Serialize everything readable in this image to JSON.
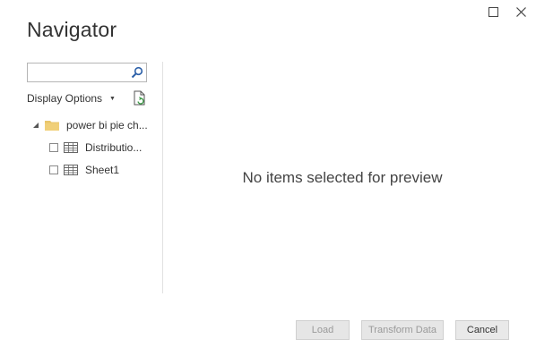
{
  "window": {
    "maximize_icon": "maximize-icon",
    "close_icon": "close-icon",
    "close_glyph": "✕"
  },
  "header": {
    "title": "Navigator"
  },
  "sidebar": {
    "search": {
      "value": "",
      "placeholder": "",
      "icon": "search-icon"
    },
    "display_options_label": "Display Options",
    "display_options_caret": "▼",
    "refresh_icon": "refresh-file-icon",
    "tree": {
      "root": {
        "label": "power bi pie ch...",
        "icon": "folder-icon",
        "expanded": true
      },
      "items": [
        {
          "label": "Distributio...",
          "icon": "table-icon",
          "checked": false
        },
        {
          "label": "Sheet1",
          "icon": "table-icon",
          "checked": false
        }
      ]
    }
  },
  "preview": {
    "message": "No items selected for preview"
  },
  "footer": {
    "load_label": "Load",
    "transform_label": "Transform Data",
    "cancel_label": "Cancel"
  },
  "colors": {
    "folder": "#e8c56a",
    "search_icon": "#2b5fa8",
    "refresh_green": "#3a9a45"
  }
}
